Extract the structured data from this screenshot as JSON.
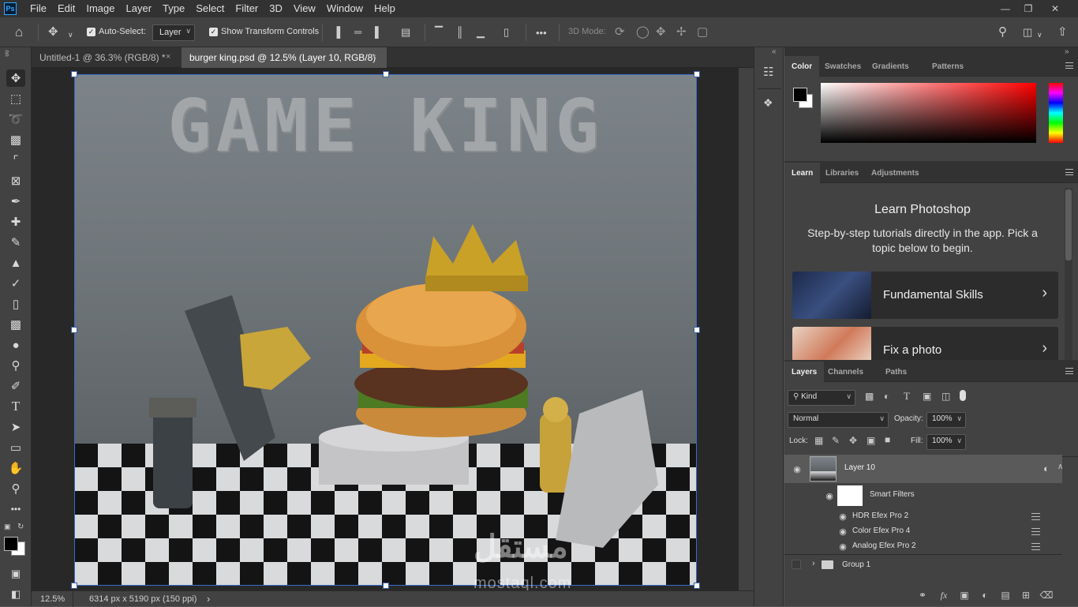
{
  "app": {
    "logo": "Ps"
  },
  "menu": [
    "File",
    "Edit",
    "Image",
    "Layer",
    "Type",
    "Select",
    "Filter",
    "3D",
    "View",
    "Window",
    "Help"
  ],
  "options": {
    "auto_select_label": "Auto-Select:",
    "auto_select_value": "Layer",
    "transform_label": "Show Transform Controls",
    "mode_3d_label": "3D Mode:",
    "more": "•••"
  },
  "tabs": [
    {
      "label": "Untitled-1 @ 36.3% (RGB/8) *",
      "close": "×"
    },
    {
      "label": "burger king.psd @ 12.5% (Layer 10, RGB/8)",
      "close": "×"
    }
  ],
  "canvas": {
    "title": "GAME KING"
  },
  "watermark": {
    "logo": "مستقل",
    "url": "mostaql.com"
  },
  "status": {
    "zoom": "12.5%",
    "doc_info": "6314 px x 5190 px (150 ppi)",
    "arrow": "›"
  },
  "color_panel": {
    "tabs": [
      "Color",
      "Swatches",
      "Gradients",
      "Patterns"
    ],
    "active": 0
  },
  "learn_panel": {
    "tabs": [
      "Learn",
      "Libraries",
      "Adjustments"
    ],
    "title": "Learn Photoshop",
    "subtitle": "Step-by-step tutorials directly in the app. Pick a topic below to begin.",
    "cards": [
      {
        "label": "Fundamental Skills",
        "chev": "›"
      },
      {
        "label": "Fix a photo",
        "chev": "›"
      }
    ]
  },
  "layers_panel": {
    "tabs": [
      "Layers",
      "Channels",
      "Paths"
    ],
    "kind_label": "Kind",
    "blend_mode": "Normal",
    "opacity_label": "Opacity:",
    "opacity_value": "100%",
    "lock_label": "Lock:",
    "fill_label": "Fill:",
    "fill_value": "100%",
    "layer10": "Layer 10",
    "smart_filters": "Smart Filters",
    "filters": [
      "HDR Efex Pro 2",
      "Color Efex Pro 4",
      "Analog Efex Pro 2"
    ],
    "group1": "Group 1"
  }
}
